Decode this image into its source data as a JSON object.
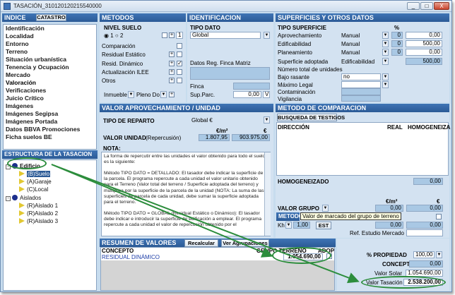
{
  "window": {
    "title": "TASACIÓN_310120120215540000",
    "min": "_",
    "max": "□",
    "close": "X"
  },
  "colors": {
    "header": "#2b5a96",
    "panel": "#d3e2f1",
    "highlight": "#2c8d3c"
  },
  "index": {
    "header": "INDICE",
    "catastro": "CATASTRO",
    "items": [
      "Identificación",
      "Localidad",
      "Entorno",
      "Terreno",
      "Situación urbanística",
      "Tenencia y Ocupación",
      "Mercado",
      "Valoración",
      "Verificaciones",
      "Juicio Crítico",
      "Imágenes",
      "Imágenes Segipsa",
      "Imágenes Portada",
      "Datos BBVA Promociones",
      "Ficha suelos BE"
    ]
  },
  "estructura": {
    "header": "ESTRUCTURA DE LA TASACION",
    "edificio": "Edificio",
    "nodes1": [
      "(B)Suelo",
      "(A)Garaje",
      "(C)Local"
    ],
    "aislados": "Aislados",
    "nodes2": [
      "(R)Aislado 1",
      "(R)Aislado 2",
      "(R)Aislado 3"
    ]
  },
  "metodos": {
    "header": "METODOS",
    "nivel_suelo": "NIVEL SUELO",
    "opt1": "1",
    "opt2": "2",
    "items": [
      "Comparación",
      "Residual Estático",
      "Resid. Dinámico",
      "Actualización ILEE",
      "Otros"
    ],
    "inmueble": "Inmueble",
    "pleno": "Pleno Do"
  },
  "identificacion": {
    "header": "IDENTIFICACION",
    "tipo_dato": "TIPO DATO",
    "tipo_val": "Global",
    "datos_reg": "Datos Reg. Finca Matriz",
    "finca": "Finca",
    "sup_parc": "Sup.Parc.",
    "sup_val": "0,00",
    "unit": "V"
  },
  "superficies": {
    "header": "SUPERFICIES Y OTROS DATOS",
    "tipo": "TIPO SUPERFICIE",
    "pct": "%",
    "rows": [
      {
        "label": "Aprovechamiento",
        "sel": "Manual",
        "pct": "0",
        "val": "0,00"
      },
      {
        "label": "Edificabilidad",
        "sel": "Manual",
        "pct": "0",
        "val": "500,00"
      },
      {
        "label": "Planeamiento",
        "sel": "Manual",
        "pct": "0",
        "val": "0,00"
      }
    ],
    "adoptada": "Superficie adoptada",
    "adoptada_sel": "Edificabilidad",
    "adoptada_val": "500,00",
    "num_viviendas": "Número total de unidades",
    "bajo": "Bajo rasante",
    "bajo_val": "no",
    "maximo": "Máximo Legal",
    "contaminacion": "Contaminación",
    "vigilancia": "Vigilancia"
  },
  "aprovechamiento": {
    "header": "VALOR APROVECHAMIENTO / UNIDAD",
    "tipo_reparto": "TIPO DE REPARTO",
    "reparto_val": "Global €",
    "eur_m2": "€/m²",
    "eur": "€",
    "valor_unidad": "VALOR UNIDAD",
    "repercusion": "(Repercusión)",
    "v1": "1.807,95",
    "v2": "903.975,00",
    "nota": "NOTA:",
    "nota_text": "La forma de repercutir entre las unidades el valor obtenido para todo el suelo es la siguiente:\n\nMétodo TIPO DATO = DETALLADO: El tasador debe indicar la superficie de la parcela. El programa repercute a cada unidad el valor unitario obtenido para el Terreno (Valor total del terreno / Superficie adoptada del terreno) y multiplica por la superficie de la parcela de la unidad (NOTA: La suma de las superficies de parcela de cada unidad, debe sumar la superficie adoptada para el terreno.\n\nMétodo TIPO DATO = GLOBAL (Residual Estático o Dinámico): El tasador debe indicar e introducir la superficie de edificación a emplear. El programa repercute a cada unidad el valor de repercusión obtenido por el"
  },
  "comparacion": {
    "header": "METODO DE COMPARACION",
    "busqueda": "BUSQUEDA DE TESTIGOS",
    "cols": [
      "DIRECCIÓN",
      "REAL",
      "HOMOGENEIZA"
    ],
    "homogeneizado": "HOMOGENEIZADO",
    "homog_val": "0,00",
    "eur_m2": "€/m²",
    "eur": "€",
    "valor_grupo": "VALOR GRUPO",
    "vg1": "0,00",
    "vg2": "0,00",
    "metodo": "METODO",
    "tooltip": "Valor de marcado del grupo de terreno",
    "kh": "Kh",
    "kh_val": "1,00",
    "est": "EST",
    "e1": "0,00",
    "e2": "0,00",
    "ref": "Ref. Estudio Mercado"
  },
  "resumen": {
    "header": "RESUMEN DE VALORES",
    "recalcular": "Recalcular",
    "ver": "Ver Agrupaciones",
    "concepto": "CONCEPTO",
    "grupo": "GRUPO TERRENO",
    "adop": "ADOP",
    "row_concepto": "RESIDUAL DINÁMICO",
    "row_val": "1.054.690,00",
    "pct_propiedad": "% PROPIEDAD",
    "pct_val": "100,00",
    "concepto2": "CONCEPTO",
    "concepto2_val": "0,00",
    "valor_solar": "Valor Solar",
    "valor_solar_val": "1.054.690,00",
    "valor_tasacion": "Valor Tasación",
    "valor_tasacion_val": "2.538.200,00"
  }
}
